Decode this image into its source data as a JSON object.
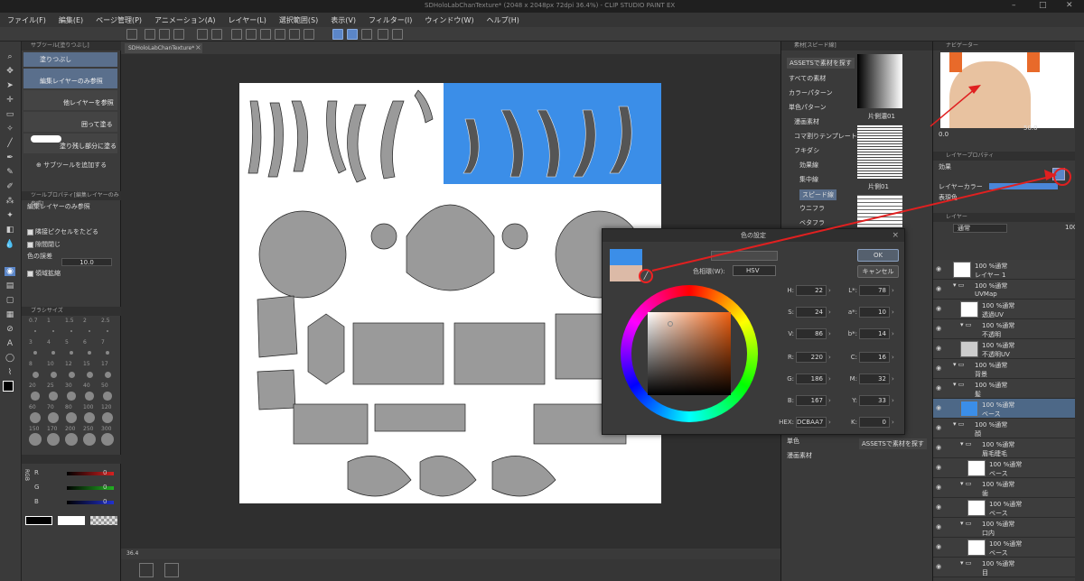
{
  "window": {
    "title": "SDHoloLabChanTexture* (2048 x 2048px 72dpi 36.4%) - CLIP STUDIO PAINT EX",
    "controls": [
      "–",
      "□",
      "✕"
    ]
  },
  "menu": [
    "ファイル(F)",
    "編集(E)",
    "ページ管理(P)",
    "アニメーション(A)",
    "レイヤー(L)",
    "選択範囲(S)",
    "表示(V)",
    "フィルター(I)",
    "ウィンドウ(W)",
    "ヘルプ(H)"
  ],
  "subtool": {
    "header": "サブツール[塗りつぶし]",
    "items": [
      {
        "label": "塗りつぶし",
        "selected": true
      },
      {
        "label": "編集レイヤーのみ参照",
        "selected": true
      },
      {
        "label": "他レイヤーを参照",
        "selected": false
      },
      {
        "label": "囲って塗る",
        "selected": false
      },
      {
        "label": "塗り残し部分に塗る",
        "selected": false
      }
    ],
    "add": "サブツールを追加する"
  },
  "toolprop": {
    "header": "ツールプロパティ[編集レイヤーのみ参照]",
    "name": "編集レイヤーのみ参照",
    "rows": [
      "隣接ピクセルをたどる",
      "隙間閉じ",
      "色の誤差",
      "領域拡縮"
    ],
    "tolerance": "10.0"
  },
  "brushsize": {
    "header": "ブラシサイズ",
    "sizes": [
      "0.7",
      "1",
      "1.5",
      "2",
      "2.5",
      "3",
      "4",
      "5",
      "6",
      "7",
      "8",
      "10",
      "12",
      "15",
      "17",
      "20",
      "25",
      "30",
      "40",
      "50",
      "60",
      "70",
      "80",
      "100",
      "120",
      "150",
      "170",
      "200",
      "250",
      "300"
    ]
  },
  "colorbars": {
    "mode": "RGB",
    "rows": [
      {
        "label": "R",
        "value": "0",
        "color": "#d62020"
      },
      {
        "label": "G",
        "value": "0",
        "color": "#22b022"
      },
      {
        "label": "B",
        "value": "0",
        "color": "#2030d0"
      }
    ]
  },
  "canvas": {
    "tab": "SDHoloLabChanTexture*",
    "zoom": "36.4",
    "bg": "#3b8ee8"
  },
  "materials": {
    "header": "素材[スピード線]",
    "assets_button": "ASSETSで素材を探す",
    "tree": [
      {
        "label": "すべての素材",
        "selected": false
      },
      {
        "label": "カラーパターン",
        "selected": false
      },
      {
        "label": "単色パターン",
        "selected": false
      },
      {
        "label": "漫画素材",
        "selected": false
      },
      {
        "label": "コマ割りテンプレート",
        "selected": false
      },
      {
        "label": "フキダシ",
        "selected": false
      },
      {
        "label": "効果線",
        "selected": false
      },
      {
        "label": "集中線",
        "selected": false
      },
      {
        "label": "スピード線",
        "selected": true
      },
      {
        "label": "ウニフラ",
        "selected": false
      },
      {
        "label": "ベタフラ",
        "selected": false
      }
    ],
    "thumbs": [
      "片側濃01",
      "片側01",
      ""
    ],
    "bottom": [
      "単色",
      "漫画素材"
    ],
    "assets_bottom": "ASSETSで素材を探す"
  },
  "navigator": {
    "header": "ナビゲーター",
    "zoom": "50.0",
    "angle": "0.0"
  },
  "layerprop": {
    "header": "レイヤープロパティ",
    "effect": "効果",
    "layercolor": "レイヤーカラー",
    "display": "表現色"
  },
  "layers": {
    "header": "レイヤー",
    "blend": "通常",
    "opacity": "100",
    "items": [
      {
        "indent": 1,
        "l1": "100 %通常",
        "l2": "レイヤー 1",
        "type": "layer",
        "thumb": "#fff",
        "sel": false
      },
      {
        "indent": 1,
        "l1": "100 %通常",
        "l2": "UVMap",
        "type": "folder",
        "sel": false
      },
      {
        "indent": 2,
        "l1": "100 %通常",
        "l2": "透過UV",
        "type": "layer",
        "thumb": "#fff",
        "sel": false
      },
      {
        "indent": 2,
        "l1": "100 %通常",
        "l2": "不透明",
        "type": "folder",
        "sel": false
      },
      {
        "indent": 2,
        "l1": "100 %通常",
        "l2": "不透明UV",
        "type": "layer",
        "thumb": "#ccc",
        "sel": false
      },
      {
        "indent": 1,
        "l1": "100 %通常",
        "l2": "背景",
        "type": "folder",
        "sel": false
      },
      {
        "indent": 1,
        "l1": "100 %通常",
        "l2": "髪",
        "type": "folder",
        "sel": false
      },
      {
        "indent": 2,
        "l1": "100 %通常",
        "l2": "ベース",
        "type": "layer",
        "thumb": "#3b8ee8",
        "sel": true
      },
      {
        "indent": 1,
        "l1": "100 %通常",
        "l2": "顔",
        "type": "folder",
        "sel": false
      },
      {
        "indent": 2,
        "l1": "100 %通常",
        "l2": "眉毛睫毛",
        "type": "folder",
        "sel": false
      },
      {
        "indent": 3,
        "l1": "100 %通常",
        "l2": "ベース",
        "type": "layer",
        "thumb": "#fff",
        "sel": false
      },
      {
        "indent": 2,
        "l1": "100 %通常",
        "l2": "歯",
        "type": "folder",
        "sel": false
      },
      {
        "indent": 3,
        "l1": "100 %通常",
        "l2": "ベース",
        "type": "layer",
        "thumb": "#fff",
        "sel": false
      },
      {
        "indent": 2,
        "l1": "100 %通常",
        "l2": "口内",
        "type": "folder",
        "sel": false
      },
      {
        "indent": 3,
        "l1": "100 %通常",
        "l2": "ベース",
        "type": "layer",
        "thumb": "#fff",
        "sel": false
      },
      {
        "indent": 2,
        "l1": "100 %通常",
        "l2": "目",
        "type": "folder",
        "sel": false
      }
    ]
  },
  "colordialog": {
    "title": "色の設定",
    "ok": "OK",
    "cancel": "キャンセル",
    "space_label": "色相環(W):",
    "space": "HSV",
    "main_color": "#3b8ee8",
    "sub_color": "#dcbaa7",
    "fields_left": [
      {
        "k": "H:",
        "v": "22"
      },
      {
        "k": "S:",
        "v": "24"
      },
      {
        "k": "V:",
        "v": "86"
      },
      {
        "k": "R:",
        "v": "220"
      },
      {
        "k": "G:",
        "v": "186"
      },
      {
        "k": "B:",
        "v": "167"
      },
      {
        "k": "HEX:",
        "v": "DCBAA7"
      }
    ],
    "fields_right": [
      {
        "k": "L*:",
        "v": "78"
      },
      {
        "k": "a*:",
        "v": "10"
      },
      {
        "k": "b*:",
        "v": "14"
      },
      {
        "k": "C:",
        "v": "16"
      },
      {
        "k": "M:",
        "v": "32"
      },
      {
        "k": "Y:",
        "v": "33"
      },
      {
        "k": "K:",
        "v": "0"
      }
    ]
  }
}
